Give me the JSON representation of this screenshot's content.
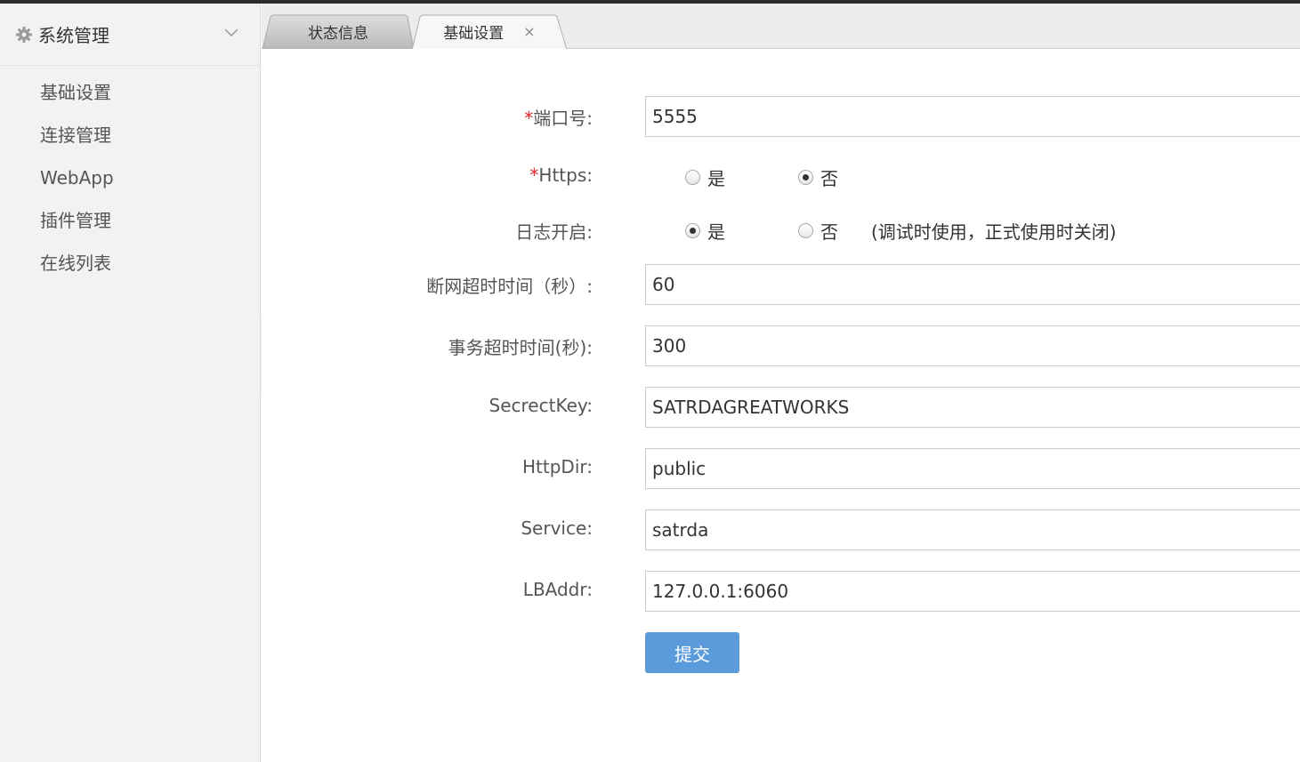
{
  "sidebar": {
    "title": "系统管理",
    "icon": "gear-icon",
    "items": [
      {
        "label": "基础设置"
      },
      {
        "label": "连接管理"
      },
      {
        "label": "WebApp"
      },
      {
        "label": "插件管理"
      },
      {
        "label": "在线列表"
      }
    ]
  },
  "tabs": [
    {
      "label": "状态信息",
      "active": false
    },
    {
      "label": "基础设置",
      "active": true,
      "close": "×"
    }
  ],
  "form": {
    "required_mark": "*",
    "port": {
      "label": "端口号:",
      "value": "5555"
    },
    "https": {
      "label": "Https:",
      "options": [
        "是",
        "否"
      ],
      "selected": "否"
    },
    "log": {
      "label": "日志开启:",
      "options": [
        "是",
        "否"
      ],
      "selected": "是",
      "note": "(调试时使用，正式使用时关闭)"
    },
    "disconnect_timeout": {
      "label": "断网超时时间（秒）:",
      "value": "60"
    },
    "transaction_timeout": {
      "label": "事务超时时间(秒):",
      "value": "300"
    },
    "secret_key": {
      "label": "SecrectKey:",
      "value": "SATRDAGREATWORKS"
    },
    "http_dir": {
      "label": "HttpDir:",
      "value": "public"
    },
    "service": {
      "label": "Service:",
      "value": "satrda"
    },
    "lb_addr": {
      "label": "LBAddr:",
      "value": "127.0.0.1:6060"
    },
    "submit_label": "提交"
  },
  "colors": {
    "accent": "#5b9bdc",
    "required": "#e02020",
    "sidebar_bg": "#f2f2f2"
  }
}
